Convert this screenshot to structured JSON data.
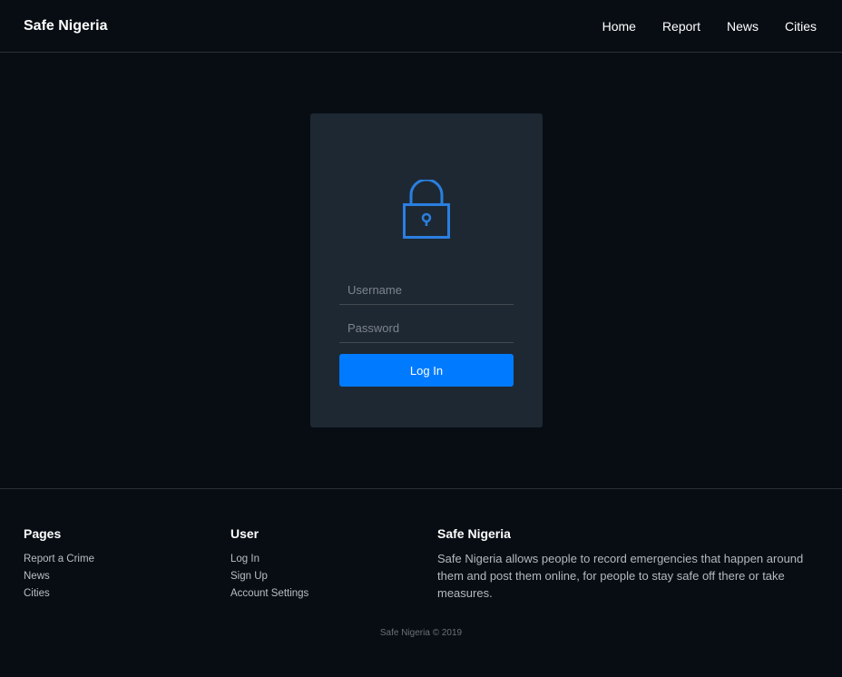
{
  "navbar": {
    "brand": "Safe Nigeria",
    "links": [
      "Home",
      "Report",
      "News",
      "Cities"
    ]
  },
  "login": {
    "username_placeholder": "Username",
    "password_placeholder": "Password",
    "button_label": "Log In",
    "icon": "lock-icon",
    "accent_color": "#007bff"
  },
  "footer": {
    "pages": {
      "title": "Pages",
      "links": [
        "Report a Crime",
        "News",
        "Cities"
      ]
    },
    "user": {
      "title": "User",
      "links": [
        "Log In",
        "Sign Up",
        "Account Settings"
      ]
    },
    "about": {
      "title": "Safe Nigeria",
      "text": "Safe Nigeria allows people to record emergencies that happen around them and post them online, for people to stay safe off there or take measures."
    },
    "copyright": "Safe Nigeria © 2019"
  }
}
